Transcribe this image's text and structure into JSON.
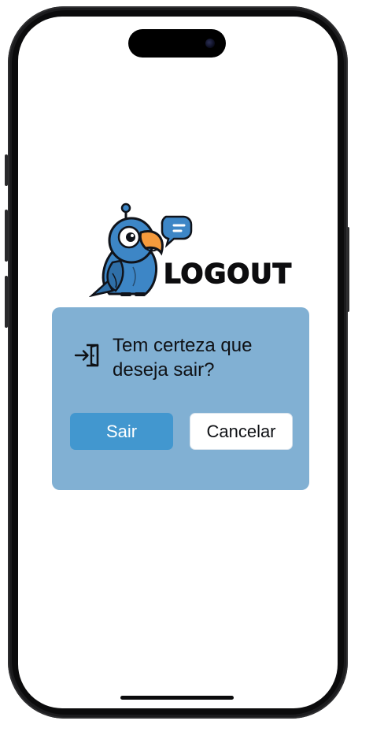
{
  "logo": {
    "text": "LOGOUT",
    "mascot": "parrot-mascot-with-chat-bubble"
  },
  "dialog": {
    "icon": "login-door-icon",
    "message": "Tem certeza que deseja sair?",
    "confirm_label": "Sair",
    "cancel_label": "Cancelar"
  },
  "colors": {
    "dialog_background": "#81b0d3",
    "confirm_button": "#4297cf",
    "cancel_button": "#ffffff",
    "mascot_blue": "#3d86c6",
    "mascot_beak": "#f59a3c"
  }
}
